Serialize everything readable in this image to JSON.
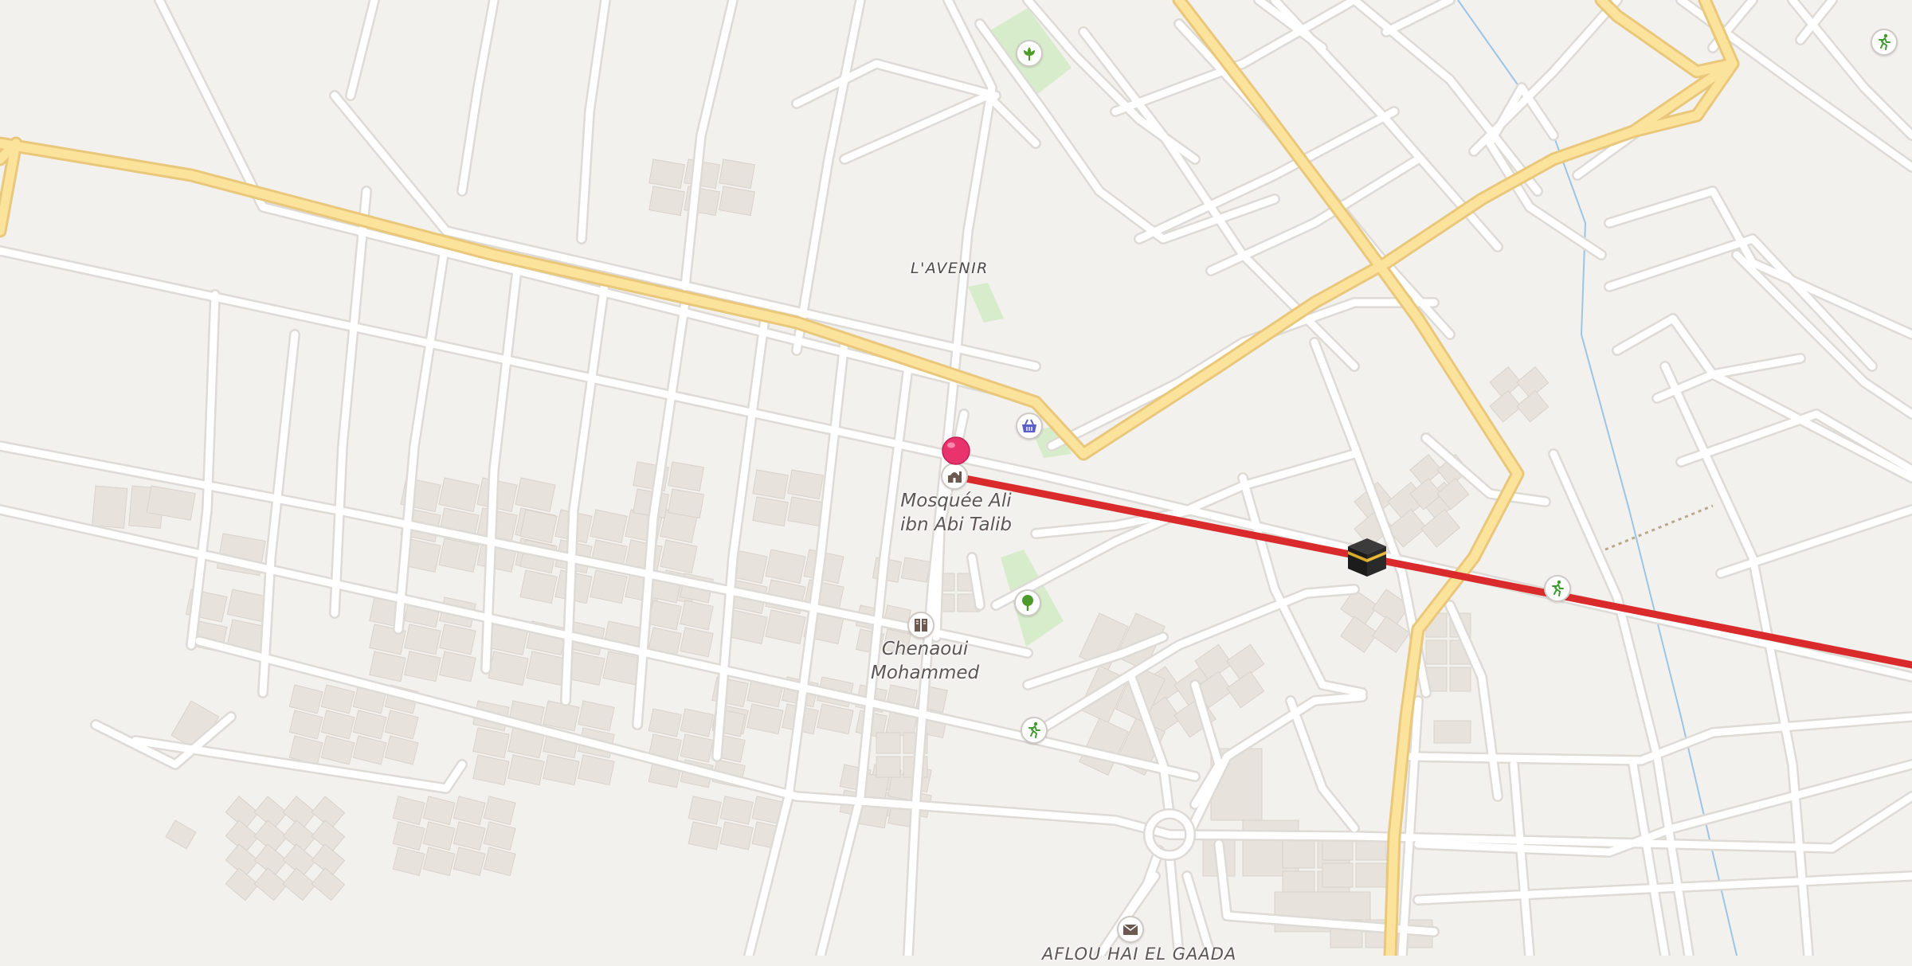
{
  "map": {
    "colors": {
      "background": "#f3f1ee",
      "road_minor": "#ffffff",
      "road_minor_casing": "#dedad5",
      "road_major": "#fce39c",
      "road_major_casing": "#e9c77b",
      "building": "#e8e2dd",
      "park": "#d7eccb",
      "waterway": "#9bc4e6",
      "route_line": "#d92b2b",
      "pin": "#e8336d"
    },
    "labels": {
      "district": "L'AVENIR",
      "mosque_line1": "Mosquée Ali",
      "mosque_line2": "ibn Abi Talib",
      "school_line1": "Chenaoui",
      "school_line2": "Mohammed",
      "bottom_partial": "AFLOU HAI EL GAADA"
    },
    "icons": {
      "pin": "location-pin-icon",
      "mosque": "mosque-icon",
      "destination": "kaaba-icon",
      "shop": "shopping-basket-icon",
      "park": "tree-icon",
      "garden": "flower-icon",
      "sport": "running-person-icon",
      "school": "school-icon",
      "post": "envelope-icon"
    }
  }
}
